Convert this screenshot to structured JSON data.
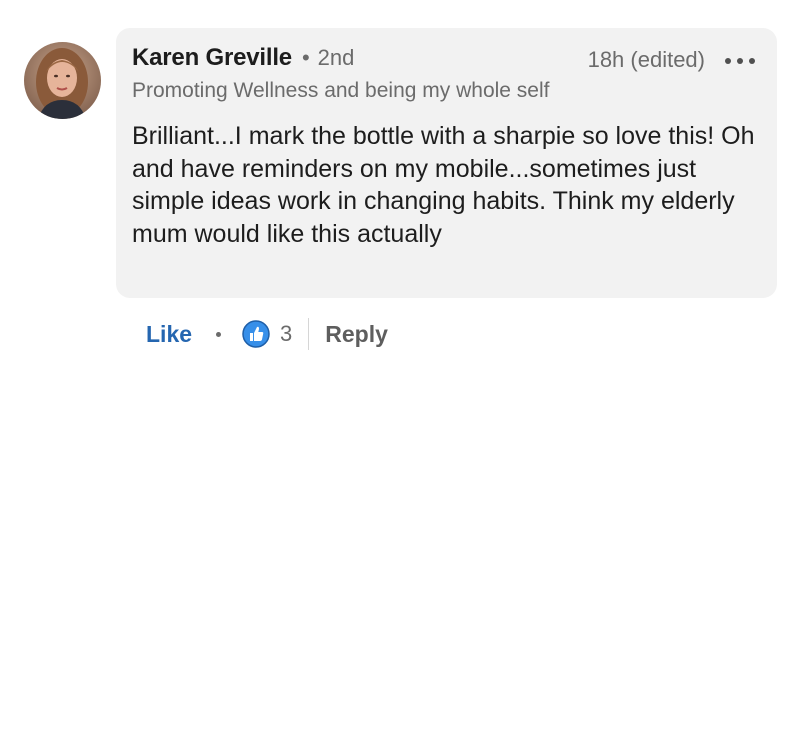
{
  "comment": {
    "author": {
      "name": "Karen Greville",
      "separator": "•",
      "degree": "2nd",
      "headline": "Promoting Wellness and being my whole self"
    },
    "timestamp": "18h (edited)",
    "text": "Brilliant...I mark the bottle with a sharpie so love this! Oh and have reminders on my mobile...sometimes just simple ideas work in changing habits. Think my elderly mum would like this actually"
  },
  "actions": {
    "like_label": "Like",
    "reaction_count": "3",
    "reply_label": "Reply"
  },
  "icons": {
    "more": "more-options-icon",
    "reaction": "like-reaction-icon"
  },
  "colors": {
    "bubble_background": "#f2f2f2",
    "like_blue": "#2566b0",
    "reaction_blue": "#378fe9",
    "secondary_text": "#6b6b6b"
  }
}
